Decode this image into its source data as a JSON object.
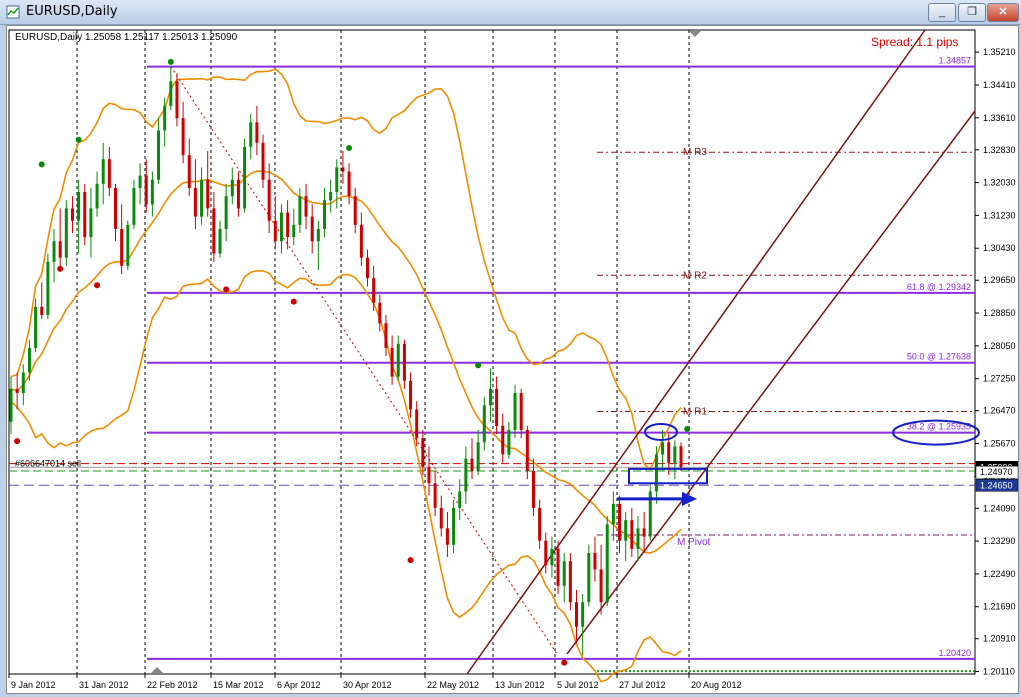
{
  "window": {
    "title": "EURUSD,Daily",
    "minimize": "_",
    "restore": "❐",
    "close": "✕"
  },
  "chart_data": {
    "type": "candlestick",
    "title": "EURUSD,Daily",
    "ohlc_label": "EURUSD,Daily  1.25058 1.25117 1.25013 1.25090",
    "spread_label": "Spread: 1.1 pips",
    "y_range": [
      1.2005,
      1.3575
    ],
    "y_ticks": [
      "1.35210",
      "1.34410",
      "1.33610",
      "1.32830",
      "1.32030",
      "1.31230",
      "1.30430",
      "1.29650",
      "1.28850",
      "1.28050",
      "1.27250",
      "1.26470",
      "1.25670",
      "1.24870",
      "1.24090",
      "1.23290",
      "1.22490",
      "1.21690",
      "1.20910",
      "1.20110"
    ],
    "x_ticks": [
      "9 Jan 2012",
      "31 Jan 2012",
      "22 Feb 2012",
      "15 Mar 2012",
      "6 Apr 2012",
      "30 Apr 2012",
      "22 May 2012",
      "13 Jun 2012",
      "5 Jul 2012",
      "27 Jul 2012",
      "20 Aug 2012"
    ],
    "price_tags": [
      {
        "label": "1.25090",
        "value": 1.2509,
        "bg": "#000000",
        "fg": "#ffffff"
      },
      {
        "label": "1.24970",
        "value": 1.2497,
        "bg": "#ffffff",
        "fg": "#000000"
      },
      {
        "label": "1.24650",
        "value": 1.2465,
        "bg": "#1f3a93",
        "fg": "#ffffff"
      }
    ],
    "horizontal_levels": [
      {
        "label": "1.34857",
        "value": 1.34857,
        "color": "#8b2be2",
        "style": "solid"
      },
      {
        "label": "61.8 @ 1.29342",
        "value": 1.29342,
        "color": "#8b2be2",
        "style": "solid"
      },
      {
        "label": "50.0 @ 1.27638",
        "value": 1.27638,
        "color": "#8b2be2",
        "style": "solid"
      },
      {
        "label": "38.2 @ 1.25935",
        "value": 1.25935,
        "color": "#8b2be2",
        "style": "solid"
      },
      {
        "label": "1.20420",
        "value": 1.2042,
        "color": "#8b2be2",
        "style": "solid"
      }
    ],
    "pivot_levels": [
      {
        "label": "M R3",
        "value": 1.3277
      },
      {
        "label": "M R2",
        "value": 1.2977
      },
      {
        "label": "M R1",
        "value": 1.2645
      },
      {
        "label": "M Pivot",
        "value": 1.2344
      }
    ],
    "order_label": "#606647014 sell",
    "candles": [
      [
        1.262,
        1.273,
        1.259,
        1.27
      ],
      [
        1.27,
        1.274,
        1.265,
        1.269
      ],
      [
        1.269,
        1.276,
        1.266,
        1.274
      ],
      [
        1.274,
        1.282,
        1.272,
        1.28
      ],
      [
        1.28,
        1.292,
        1.279,
        1.29
      ],
      [
        1.29,
        1.296,
        1.287,
        1.288
      ],
      [
        1.288,
        1.303,
        1.287,
        1.301
      ],
      [
        1.301,
        1.309,
        1.296,
        1.306
      ],
      [
        1.306,
        1.314,
        1.299,
        1.302
      ],
      [
        1.302,
        1.316,
        1.3,
        1.314
      ],
      [
        1.314,
        1.317,
        1.308,
        1.311
      ],
      [
        1.311,
        1.321,
        1.303,
        1.318
      ],
      [
        1.318,
        1.32,
        1.305,
        1.307
      ],
      [
        1.307,
        1.319,
        1.302,
        1.314
      ],
      [
        1.314,
        1.323,
        1.312,
        1.32
      ],
      [
        1.32,
        1.33,
        1.315,
        1.326
      ],
      [
        1.326,
        1.329,
        1.317,
        1.319
      ],
      [
        1.319,
        1.32,
        1.306,
        1.309
      ],
      [
        1.309,
        1.315,
        1.298,
        1.3
      ],
      [
        1.3,
        1.311,
        1.299,
        1.31
      ],
      [
        1.31,
        1.321,
        1.309,
        1.319
      ],
      [
        1.319,
        1.325,
        1.315,
        1.322
      ],
      [
        1.322,
        1.326,
        1.313,
        1.315
      ],
      [
        1.315,
        1.323,
        1.312,
        1.321
      ],
      [
        1.321,
        1.336,
        1.32,
        1.333
      ],
      [
        1.333,
        1.341,
        1.329,
        1.339
      ],
      [
        1.339,
        1.3486,
        1.338,
        1.345
      ],
      [
        1.345,
        1.347,
        1.334,
        1.336
      ],
      [
        1.336,
        1.34,
        1.325,
        1.327
      ],
      [
        1.327,
        1.331,
        1.317,
        1.319
      ],
      [
        1.319,
        1.326,
        1.309,
        1.312
      ],
      [
        1.312,
        1.324,
        1.31,
        1.321
      ],
      [
        1.321,
        1.328,
        1.312,
        1.314
      ],
      [
        1.314,
        1.318,
        1.301,
        1.303
      ],
      [
        1.303,
        1.311,
        1.302,
        1.309
      ],
      [
        1.309,
        1.32,
        1.306,
        1.317
      ],
      [
        1.317,
        1.324,
        1.315,
        1.321
      ],
      [
        1.321,
        1.323,
        1.312,
        1.314
      ],
      [
        1.314,
        1.331,
        1.313,
        1.329
      ],
      [
        1.329,
        1.337,
        1.326,
        1.335
      ],
      [
        1.335,
        1.339,
        1.327,
        1.33
      ],
      [
        1.33,
        1.332,
        1.319,
        1.321
      ],
      [
        1.321,
        1.325,
        1.308,
        1.311
      ],
      [
        1.311,
        1.317,
        1.304,
        1.306
      ],
      [
        1.306,
        1.315,
        1.303,
        1.313
      ],
      [
        1.313,
        1.316,
        1.304,
        1.307
      ],
      [
        1.307,
        1.314,
        1.305,
        1.31
      ],
      [
        1.31,
        1.319,
        1.308,
        1.317
      ],
      [
        1.317,
        1.32,
        1.309,
        1.312
      ],
      [
        1.312,
        1.315,
        1.303,
        1.306
      ],
      [
        1.306,
        1.311,
        1.299,
        1.309
      ],
      [
        1.309,
        1.319,
        1.307,
        1.316
      ],
      [
        1.316,
        1.321,
        1.313,
        1.318
      ],
      [
        1.318,
        1.326,
        1.314,
        1.324
      ],
      [
        1.324,
        1.328,
        1.32,
        1.323
      ],
      [
        1.323,
        1.325,
        1.315,
        1.317
      ],
      [
        1.317,
        1.319,
        1.308,
        1.31
      ],
      [
        1.31,
        1.313,
        1.3,
        1.302
      ],
      [
        1.302,
        1.304,
        1.295,
        1.297
      ],
      [
        1.297,
        1.3,
        1.289,
        1.291
      ],
      [
        1.291,
        1.293,
        1.284,
        1.286
      ],
      [
        1.286,
        1.288,
        1.278,
        1.28
      ],
      [
        1.28,
        1.283,
        1.271,
        1.273
      ],
      [
        1.273,
        1.283,
        1.272,
        1.281
      ],
      [
        1.281,
        1.282,
        1.27,
        1.272
      ],
      [
        1.272,
        1.274,
        1.263,
        1.265
      ],
      [
        1.265,
        1.267,
        1.256,
        1.258
      ],
      [
        1.258,
        1.26,
        1.249,
        1.251
      ],
      [
        1.251,
        1.256,
        1.244,
        1.247
      ],
      [
        1.247,
        1.25,
        1.239,
        1.241
      ],
      [
        1.241,
        1.244,
        1.234,
        1.236
      ],
      [
        1.236,
        1.24,
        1.229,
        1.232
      ],
      [
        1.232,
        1.243,
        1.23,
        1.241
      ],
      [
        1.241,
        1.248,
        1.238,
        1.245
      ],
      [
        1.245,
        1.256,
        1.242,
        1.253
      ],
      [
        1.253,
        1.258,
        1.248,
        1.25
      ],
      [
        1.25,
        1.26,
        1.249,
        1.257
      ],
      [
        1.257,
        1.268,
        1.255,
        1.266
      ],
      [
        1.266,
        1.275,
        1.262,
        1.27
      ],
      [
        1.27,
        1.273,
        1.259,
        1.261
      ],
      [
        1.261,
        1.264,
        1.252,
        1.254
      ],
      [
        1.254,
        1.262,
        1.253,
        1.26
      ],
      [
        1.26,
        1.271,
        1.258,
        1.269
      ],
      [
        1.269,
        1.27,
        1.258,
        1.26
      ],
      [
        1.26,
        1.261,
        1.248,
        1.25
      ],
      [
        1.25,
        1.253,
        1.239,
        1.241
      ],
      [
        1.241,
        1.243,
        1.231,
        1.233
      ],
      [
        1.233,
        1.235,
        1.225,
        1.227
      ],
      [
        1.227,
        1.234,
        1.224,
        1.231
      ],
      [
        1.231,
        1.233,
        1.22,
        1.222
      ],
      [
        1.222,
        1.23,
        1.218,
        1.228
      ],
      [
        1.228,
        1.23,
        1.216,
        1.218
      ],
      [
        1.218,
        1.221,
        1.208,
        1.212
      ],
      [
        1.212,
        1.22,
        1.205,
        1.218
      ],
      [
        1.218,
        1.232,
        1.217,
        1.23
      ],
      [
        1.23,
        1.234,
        1.223,
        1.226
      ],
      [
        1.226,
        1.232,
        1.215,
        1.218
      ],
      [
        1.218,
        1.239,
        1.217,
        1.237
      ],
      [
        1.237,
        1.245,
        1.233,
        1.242
      ],
      [
        1.242,
        1.244,
        1.23,
        1.233
      ],
      [
        1.233,
        1.24,
        1.228,
        1.238
      ],
      [
        1.238,
        1.241,
        1.229,
        1.231
      ],
      [
        1.231,
        1.239,
        1.228,
        1.236
      ],
      [
        1.236,
        1.24,
        1.23,
        1.234
      ],
      [
        1.234,
        1.247,
        1.233,
        1.245
      ],
      [
        1.245,
        1.256,
        1.242,
        1.254
      ],
      [
        1.254,
        1.26,
        1.25,
        1.257
      ],
      [
        1.257,
        1.259,
        1.249,
        1.252
      ],
      [
        1.252,
        1.2575,
        1.248,
        1.256
      ],
      [
        1.256,
        1.257,
        1.25,
        1.2509
      ]
    ]
  }
}
